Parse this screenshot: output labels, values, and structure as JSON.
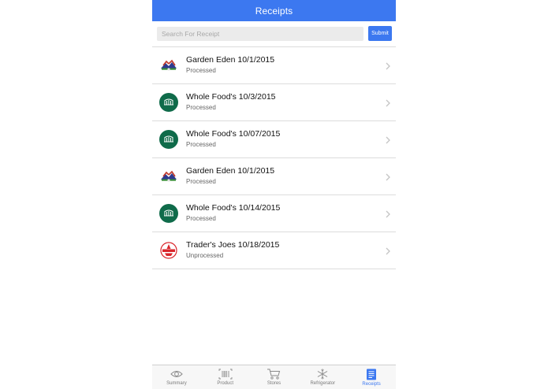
{
  "header": {
    "title": "Receipts"
  },
  "search": {
    "placeholder": "Search For Receipt",
    "value": "",
    "submit_label": "Submit"
  },
  "receipts": [
    {
      "title": "Garden Eden 10/1/2015",
      "status": "Processed",
      "store_logo": "garden-eden-logo"
    },
    {
      "title": "Whole Food's 10/3/2015",
      "status": "Processed",
      "store_logo": "whole-foods-logo"
    },
    {
      "title": "Whole Food's 10/07/2015",
      "status": "Processed",
      "store_logo": "whole-foods-logo"
    },
    {
      "title": "Garden Eden 10/1/2015",
      "status": "Processed",
      "store_logo": "garden-eden-logo"
    },
    {
      "title": "Whole Food's 10/14/2015",
      "status": "Processed",
      "store_logo": "whole-foods-logo"
    },
    {
      "title": "Trader's Joes 10/18/2015",
      "status": "Unprocessed",
      "store_logo": "trader-joes-logo"
    }
  ],
  "tabbar": {
    "tabs": [
      {
        "label": "Summary",
        "icon": "eye-icon",
        "active": false
      },
      {
        "label": "Product",
        "icon": "barcode-icon",
        "active": false
      },
      {
        "label": "Stores",
        "icon": "cart-icon",
        "active": false
      },
      {
        "label": "Refrigerator",
        "icon": "snowflake-icon",
        "active": false
      },
      {
        "label": "Receipts",
        "icon": "receipt-icon",
        "active": true
      }
    ]
  },
  "colors": {
    "accent": "#3c78f0",
    "whole_foods_green": "#0f6b4a",
    "trader_joes_red": "#d9252b",
    "divider": "#dcdcdc"
  }
}
